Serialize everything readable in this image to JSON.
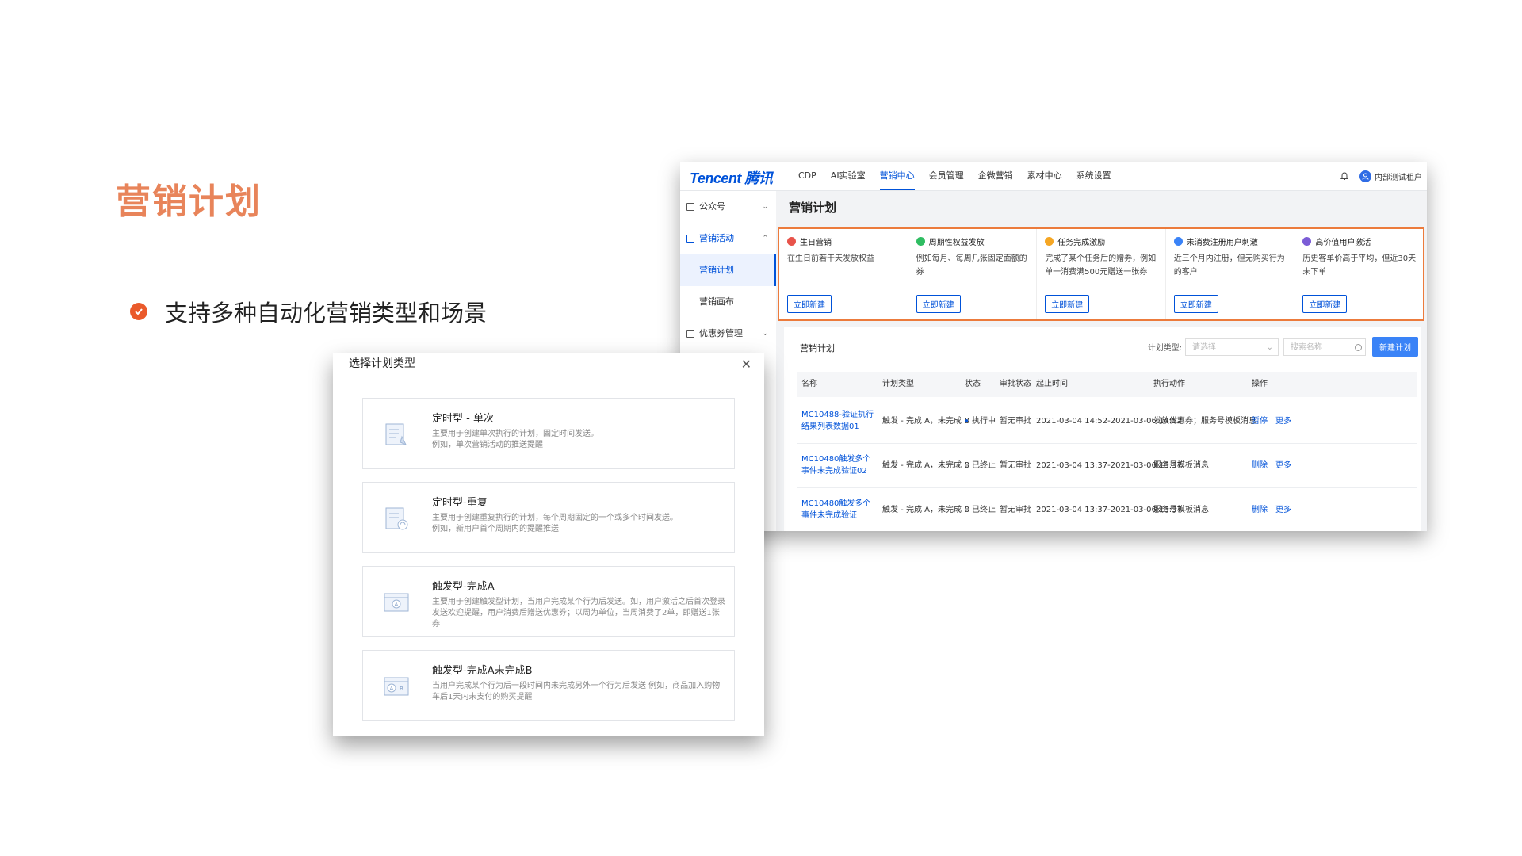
{
  "slide": {
    "title": "营销计划",
    "bullet": "支持多种自动化营销类型和场景"
  },
  "colors": {
    "accent": "#e8845a",
    "bullet": "#ea5a2b",
    "brand": "#0052d9",
    "highlight_border": "#ec7b3c"
  },
  "app": {
    "logo": "Tencent 腾讯",
    "nav": [
      "CDP",
      "AI实验室",
      "营销中心",
      "会员管理",
      "企微营销",
      "素材中心",
      "系统设置"
    ],
    "nav_active": "营销中心",
    "user": "内部测试租户",
    "sidebar": {
      "group1": "公众号",
      "group2": "营销活动",
      "sub1": "营销计划",
      "sub2": "营销画布",
      "group3": "优惠券管理"
    },
    "page_title": "营销计划",
    "cards": [
      {
        "title": "生日营销",
        "desc": "在生日前若干天发放权益",
        "button": "立即新建",
        "color": "#e8534a"
      },
      {
        "title": "周期性权益发放",
        "desc": "例如每月、每周几张固定面额的券",
        "button": "立即新建",
        "color": "#2fbd62"
      },
      {
        "title": "任务完成激励",
        "desc": "完成了某个任务后的赠券，例如单一消费满500元赠送一张券",
        "button": "立即新建",
        "color": "#f5a623"
      },
      {
        "title": "未消费注册用户刺激",
        "desc": "近三个月内注册，但无购买行为的客户",
        "button": "立即新建",
        "color": "#3a83f7"
      },
      {
        "title": "高价值用户激活",
        "desc": "历史客单价高于平均，但近30天未下单",
        "button": "立即新建",
        "color": "#7b5cd6"
      }
    ],
    "table": {
      "title": "营销计划",
      "filter_label": "计划类型:",
      "filter_placeholder": "请选择",
      "search_placeholder": "搜索名称",
      "new_button": "新建计划",
      "headers": [
        "名称",
        "计划类型",
        "状态",
        "审批状态",
        "起止时间",
        "执行动作",
        "操作"
      ],
      "rows": [
        {
          "name": "MC10488-验证执行结果列表数据01",
          "type": "触发 - 完成 A，未完成 B",
          "status": "执行中",
          "status_color": "#0052d9",
          "approval": "暂无审批",
          "time": "2021-03-04 14:52-2021-03-06 14:52",
          "action": "发放优惠券；服务号模板消息",
          "op1": "暂停",
          "op2": "更多"
        },
        {
          "name": "MC10480触发多个事件未完成验证02",
          "type": "触发 - 完成 A，未完成 B",
          "status": "已终止",
          "status_color": "#bbbbbb",
          "approval": "暂无审批",
          "time": "2021-03-04 13:37-2021-03-06 13:37",
          "action": "服务号模板消息",
          "op1": "删除",
          "op2": "更多"
        },
        {
          "name": "MC10480触发多个事件未完成验证",
          "type": "触发 - 完成 A，未完成 B",
          "status": "已终止",
          "status_color": "#bbbbbb",
          "approval": "暂无审批",
          "time": "2021-03-04 13:37-2021-03-06 13:37",
          "action": "服务号模板消息",
          "op1": "删除",
          "op2": "更多"
        }
      ]
    }
  },
  "dialog": {
    "title": "选择计划类型",
    "close_icon": "close-icon",
    "options": [
      {
        "title": "定时型 - 单次",
        "desc": "主要用于创建单次执行的计划，固定时间发送。\n例如，单次营销活动的推送提醒"
      },
      {
        "title": "定时型-重复",
        "desc": "主要用于创建重复执行的计划，每个周期固定的一个或多个时间发送。\n例如，新用户首个周期内的提醒推送"
      },
      {
        "title": "触发型-完成A",
        "desc": "主要用于创建触发型计划，当用户完成某个行为后发送。如，用户激活之后首次登录发送欢迎提醒，用户消费后赠送优惠券；以周为单位，当周消费了2单，即赠送1张券"
      },
      {
        "title": "触发型-完成A未完成B",
        "desc": "当用户完成某个行为后一段时间内未完成另外一个行为后发送 例如，商品加入购物车后1天内未支付的购买提醒"
      }
    ]
  }
}
